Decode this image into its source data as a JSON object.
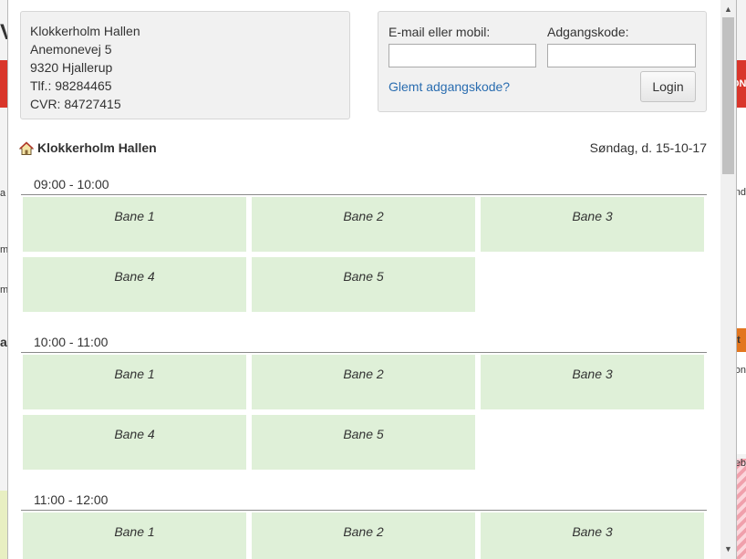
{
  "background": {
    "left_fragments": [
      "V",
      "a",
      "m",
      "m",
      "a"
    ],
    "right_top_fragment": "ON",
    "right_fragments": [
      "nd",
      "et",
      "on",
      "eb"
    ]
  },
  "address": {
    "name": "Klokkerholm Hallen",
    "street": "Anemonevej 5",
    "city": "9320 Hjallerup",
    "phone": "Tlf.: 98284465",
    "cvr": "CVR: 84727415"
  },
  "login": {
    "email_label": "E-mail eller mobil:",
    "email_value": "",
    "password_label": "Adgangskode:",
    "password_value": "",
    "forgot_label": "Glemt adgangskode?",
    "button_label": "Login"
  },
  "venue": {
    "name": "Klokkerholm Hallen",
    "date": "Søndag, d. 15-10-17"
  },
  "slots": [
    {
      "time": "09:00 - 10:00",
      "courts": [
        "Bane 1",
        "Bane 2",
        "Bane 3",
        "Bane 4",
        "Bane 5"
      ]
    },
    {
      "time": "10:00 - 11:00",
      "courts": [
        "Bane 1",
        "Bane 2",
        "Bane 3",
        "Bane 4",
        "Bane 5"
      ]
    },
    {
      "time": "11:00 - 12:00",
      "courts": [
        "Bane 1",
        "Bane 2",
        "Bane 3"
      ]
    }
  ],
  "scrollbar": {
    "up_icon": "arrow-up-icon",
    "down_icon": "arrow-down-icon"
  },
  "colors": {
    "court_bg": "#dff0d8",
    "link": "#2a6db0",
    "panel_bg": "#f1f1f1"
  }
}
